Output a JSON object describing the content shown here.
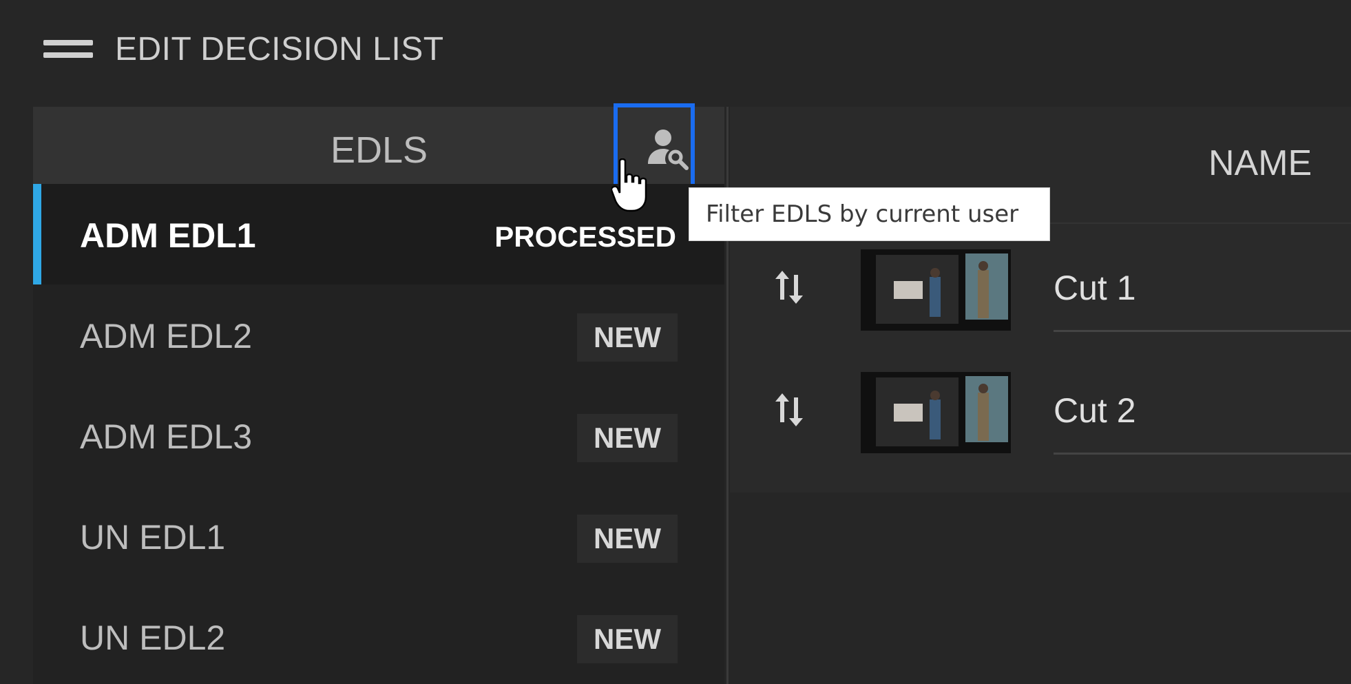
{
  "app": {
    "title": "EDIT DECISION LIST"
  },
  "edl_panel": {
    "title": "EDLS",
    "filter_tooltip": "Filter EDLS by current user",
    "items": [
      {
        "name": "ADM EDL1",
        "status": "PROCESSED",
        "selected": true
      },
      {
        "name": "ADM EDL2",
        "status": "NEW",
        "selected": false
      },
      {
        "name": "ADM EDL3",
        "status": "NEW",
        "selected": false
      },
      {
        "name": "UN EDL1",
        "status": "NEW",
        "selected": false
      },
      {
        "name": "UN EDL2",
        "status": "NEW",
        "selected": false
      }
    ]
  },
  "cuts_panel": {
    "column_name": "NAME",
    "rows": [
      {
        "name": "Cut 1"
      },
      {
        "name": "Cut 2"
      }
    ]
  },
  "colors": {
    "background": "#262626",
    "accent_selection": "#2fa8e6",
    "focus_outline": "#1a6cf0"
  },
  "icons": {
    "menu": "hamburger-menu-icon",
    "filter": "user-search-icon",
    "reorder": "swap-vertical-icon",
    "cursor": "hand-pointer-cursor"
  }
}
